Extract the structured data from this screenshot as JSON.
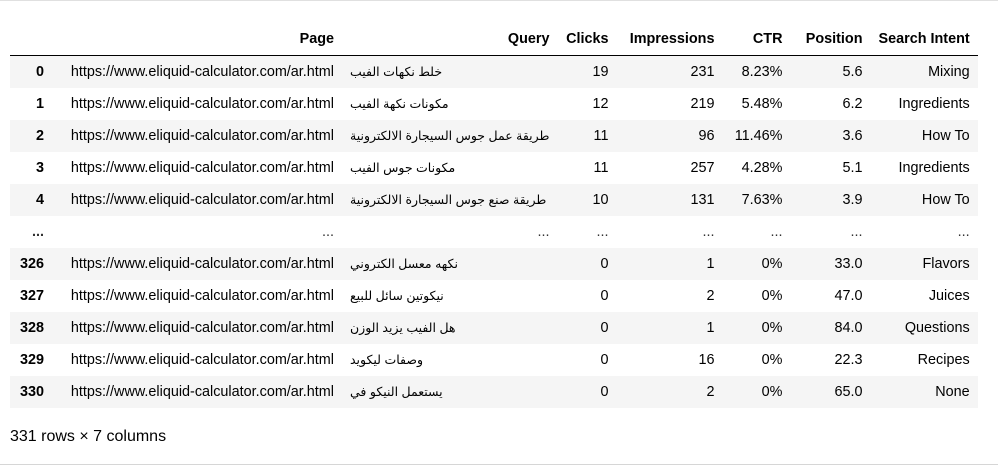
{
  "table": {
    "columns": [
      "",
      "Page",
      "Query",
      "Clicks",
      "Impressions",
      "CTR",
      "Position",
      "Search Intent"
    ],
    "rows": [
      {
        "index": "0",
        "page": "https://www.eliquid-calculator.com/ar.html",
        "query": "خلط نكهات الفيب",
        "clicks": "19",
        "impressions": "231",
        "ctr": "8.23%",
        "position": "5.6",
        "intent": "Mixing"
      },
      {
        "index": "1",
        "page": "https://www.eliquid-calculator.com/ar.html",
        "query": "مكونات نكهة الفيب",
        "clicks": "12",
        "impressions": "219",
        "ctr": "5.48%",
        "position": "6.2",
        "intent": "Ingredients"
      },
      {
        "index": "2",
        "page": "https://www.eliquid-calculator.com/ar.html",
        "query": "طريقة عمل جوس السيجارة الالكترونية",
        "clicks": "11",
        "impressions": "96",
        "ctr": "11.46%",
        "position": "3.6",
        "intent": "How To"
      },
      {
        "index": "3",
        "page": "https://www.eliquid-calculator.com/ar.html",
        "query": "مكونات جوس الفيب",
        "clicks": "11",
        "impressions": "257",
        "ctr": "4.28%",
        "position": "5.1",
        "intent": "Ingredients"
      },
      {
        "index": "4",
        "page": "https://www.eliquid-calculator.com/ar.html",
        "query": "طريقة صنع جوس السيجارة الالكترونية",
        "clicks": "10",
        "impressions": "131",
        "ctr": "7.63%",
        "position": "3.9",
        "intent": "How To"
      },
      {
        "index": "...",
        "page": "...",
        "query": "...",
        "clicks": "...",
        "impressions": "...",
        "ctr": "...",
        "position": "...",
        "intent": "..."
      },
      {
        "index": "326",
        "page": "https://www.eliquid-calculator.com/ar.html",
        "query": "نكهه معسل الكتروني",
        "clicks": "0",
        "impressions": "1",
        "ctr": "0%",
        "position": "33.0",
        "intent": "Flavors"
      },
      {
        "index": "327",
        "page": "https://www.eliquid-calculator.com/ar.html",
        "query": "نيكوتين سائل للبيع",
        "clicks": "0",
        "impressions": "2",
        "ctr": "0%",
        "position": "47.0",
        "intent": "Juices"
      },
      {
        "index": "328",
        "page": "https://www.eliquid-calculator.com/ar.html",
        "query": "هل الفيب يزيد الوزن",
        "clicks": "0",
        "impressions": "1",
        "ctr": "0%",
        "position": "84.0",
        "intent": "Questions"
      },
      {
        "index": "329",
        "page": "https://www.eliquid-calculator.com/ar.html",
        "query": "وصفات ليكويد",
        "clicks": "0",
        "impressions": "16",
        "ctr": "0%",
        "position": "22.3",
        "intent": "Recipes"
      },
      {
        "index": "330",
        "page": "https://www.eliquid-calculator.com/ar.html",
        "query": "يستعمل النيكو في",
        "clicks": "0",
        "impressions": "2",
        "ctr": "0%",
        "position": "65.0",
        "intent": "None"
      }
    ]
  },
  "shape_text": "331 rows × 7 columns"
}
